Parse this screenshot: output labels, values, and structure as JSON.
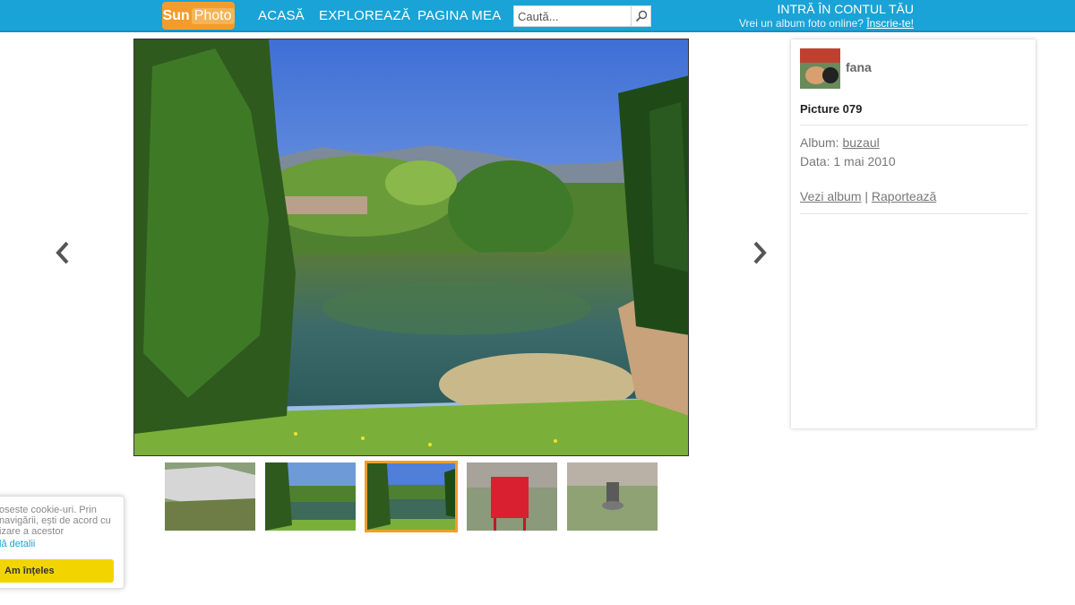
{
  "header": {
    "logo_sun": "Sun",
    "logo_photo": "Photo",
    "nav": {
      "acasa": "ACASĂ",
      "exploreaza": "EXPLOREAZĂ",
      "pagina_mea": "PAGINA MEA"
    },
    "search": {
      "placeholder": "Caută..."
    },
    "login": {
      "line1": "INTRĂ ÎN CONTUL TĂU",
      "line2": "Vrei un album foto online?",
      "signup": "Înscrie-te!"
    },
    "colors": {
      "bar": "#1aa3d6",
      "logo": "#f39c2b"
    }
  },
  "photo": {
    "thumbnails": [
      {
        "subject": "rock cliff"
      },
      {
        "subject": "lake"
      },
      {
        "subject": "lake",
        "active": true
      },
      {
        "subject": "red sign"
      },
      {
        "subject": "statue in park"
      }
    ]
  },
  "sidebar": {
    "username": "fana",
    "title": "Picture 079",
    "album_label": "Album:",
    "album_name": "buzaul",
    "date_label": "Data:",
    "date_value": "1 mai 2010",
    "view_album": "Vezi album",
    "link_sep": "|",
    "report": "Raportează"
  },
  "cookie": {
    "text": "oseste cookie-uri. Prin navigării, ești de acord cu izare a acestor",
    "more": "lă detalii",
    "button": "Am înțeles"
  }
}
